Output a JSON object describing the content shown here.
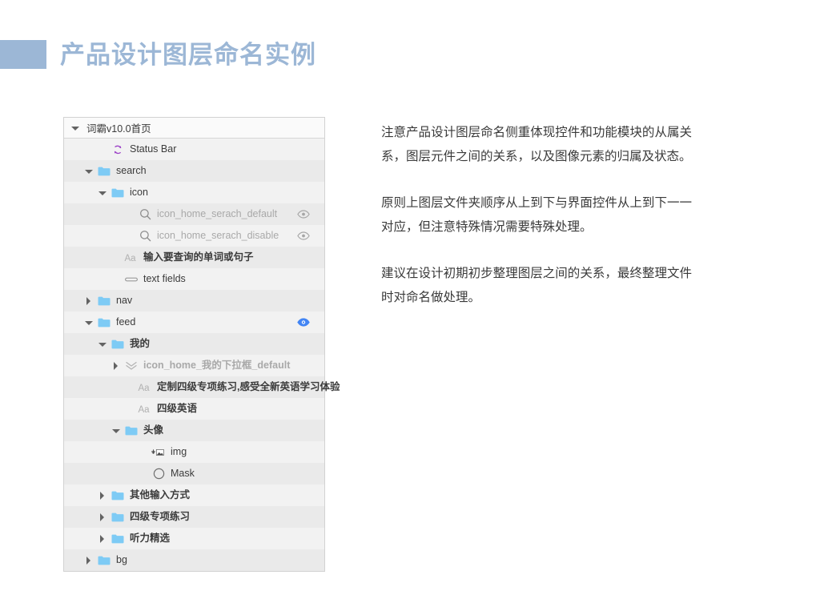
{
  "slide": {
    "title": "产品设计图层命名实例",
    "accent_color": "#9cb7d6"
  },
  "layer_panel": {
    "header": {
      "label": "词霸v10.0首页",
      "expanded": true
    },
    "rows": [
      {
        "label": "Status Bar",
        "icon": "symbol-icon",
        "indent": 2,
        "toggle": "none",
        "dim": false,
        "eye": "none"
      },
      {
        "label": "search",
        "icon": "folder-icon",
        "indent": 1,
        "toggle": "open",
        "dim": false,
        "eye": "none"
      },
      {
        "label": "icon",
        "icon": "folder-icon",
        "indent": 2,
        "toggle": "open",
        "dim": false,
        "eye": "none"
      },
      {
        "label": "icon_home_serach_default",
        "icon": "search-icon",
        "indent": 4,
        "toggle": "none",
        "dim": true,
        "eye": "gray"
      },
      {
        "label": "icon_home_serach_disable",
        "icon": "search-icon",
        "indent": 4,
        "toggle": "none",
        "dim": true,
        "eye": "gray"
      },
      {
        "label": "输入要查询的单词或句子",
        "icon": "text-layer-icon",
        "indent": 3,
        "toggle": "none",
        "dim": false,
        "eye": "none"
      },
      {
        "label": "text fields",
        "icon": "text-field-icon",
        "indent": 3,
        "toggle": "none",
        "dim": false,
        "eye": "none"
      },
      {
        "label": "nav",
        "icon": "folder-icon",
        "indent": 1,
        "toggle": "closed",
        "dim": false,
        "eye": "none"
      },
      {
        "label": "feed",
        "icon": "folder-icon",
        "indent": 1,
        "toggle": "open",
        "dim": false,
        "eye": "blue"
      },
      {
        "label": "我的",
        "icon": "folder-icon",
        "indent": 2,
        "toggle": "open",
        "dim": false,
        "eye": "none"
      },
      {
        "label": "icon_home_我的下拉框_default",
        "icon": "chevron-double-down-icon",
        "indent": 3,
        "toggle": "closed",
        "dim": true,
        "eye": "none"
      },
      {
        "label": "定制四级专项练习,感受全新英语学习体验",
        "icon": "text-layer-icon",
        "indent": 4,
        "toggle": "none",
        "dim": false,
        "eye": "none"
      },
      {
        "label": "四级英语",
        "icon": "text-layer-icon",
        "indent": 4,
        "toggle": "none",
        "dim": false,
        "eye": "none"
      },
      {
        "label": "头像",
        "icon": "folder-icon",
        "indent": 3,
        "toggle": "open",
        "dim": false,
        "eye": "none"
      },
      {
        "label": "img",
        "icon": "image-mask-icon",
        "indent": 5,
        "toggle": "none",
        "dim": false,
        "eye": "none"
      },
      {
        "label": "Mask",
        "icon": "circle-shape-icon",
        "indent": 5,
        "toggle": "none",
        "dim": false,
        "eye": "none"
      },
      {
        "label": "其他输入方式",
        "icon": "folder-icon",
        "indent": 2,
        "toggle": "closed",
        "dim": false,
        "eye": "none"
      },
      {
        "label": "四级专项练习",
        "icon": "folder-icon",
        "indent": 2,
        "toggle": "closed",
        "dim": false,
        "eye": "none"
      },
      {
        "label": "听力精选",
        "icon": "folder-icon",
        "indent": 2,
        "toggle": "closed",
        "dim": false,
        "eye": "none"
      },
      {
        "label": "bg",
        "icon": "folder-icon",
        "indent": 1,
        "toggle": "closed",
        "dim": false,
        "eye": "none"
      }
    ]
  },
  "notes": {
    "paragraphs": [
      "注意产品设计图层命名侧重体现控件和功能模块的从属关系，图层元件之间的关系，以及图像元素的归属及状态。",
      "原则上图层文件夹顺序从上到下与界面控件从上到下一一对应，但注意特殊情况需要特殊处理。",
      "建议在设计初期初步整理图层之间的关系，最终整理文件时对命名做处理。"
    ]
  }
}
